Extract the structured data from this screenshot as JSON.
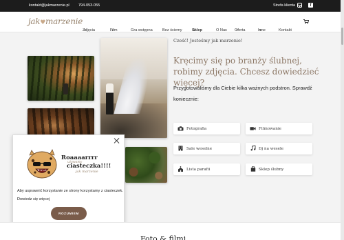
{
  "topbar": {
    "email": "kontakt@jakmarzenie.pl",
    "phone": "794-053-055",
    "client_area": "Strefa klienta"
  },
  "logo": {
    "left": "jak",
    "right": "marzenie"
  },
  "nav": {
    "items": [
      {
        "label": "Zdjęcia",
        "dropdown": true
      },
      {
        "label": "Film",
        "dropdown": true
      },
      {
        "label": "Gra wstępna",
        "dropdown": false
      },
      {
        "label": "Bez ściemy",
        "dropdown": false
      },
      {
        "label": "Sklep",
        "dropdown": true,
        "active": true
      },
      {
        "label": "O Nas",
        "dropdown": false
      },
      {
        "label": "Oferta",
        "dropdown": true
      },
      {
        "label": "Inne",
        "dropdown": true
      },
      {
        "label": "Kontakt",
        "dropdown": false
      }
    ]
  },
  "intro": {
    "small": "Cześć! Jesteśmy jak marzenie!",
    "headline": "Kręcimy się po branży ślubnej, robimy zdjęcia. Chcesz dowiedzieć więcej?",
    "sub": "Przygotowaliśmy dla Ciebie kilka ważnych podstron. Sprawdź koniecznie:"
  },
  "tiles": [
    {
      "label": "Fotografia",
      "icon": "camera-icon"
    },
    {
      "label": "Filmowanie",
      "icon": "video-camera-icon"
    },
    {
      "label": "Sale weselne",
      "icon": "building-icon"
    },
    {
      "label": "Dj na wesele",
      "icon": "music-note-icon"
    },
    {
      "label": "Lista parafii",
      "icon": "church-icon"
    },
    {
      "label": "Sklep ślubny",
      "icon": "shopping-bag-icon"
    }
  ],
  "cookie": {
    "roar": "Roaaaarrrr",
    "used": "używamy",
    "ciasteczka": "ciasteczka!!!!",
    "brand": "jak marzenie",
    "message": "Aby usprawnić korzystanie ze strony korzystamy z ciasteczek. Dowiedz się więcej",
    "button": "ROZUMIEM"
  },
  "bottom_heading": "Foto  &  filmi",
  "colors": {
    "accent": "#8c7765",
    "button_brown": "#7a5c4a",
    "topbar": "#1c1c1c"
  }
}
